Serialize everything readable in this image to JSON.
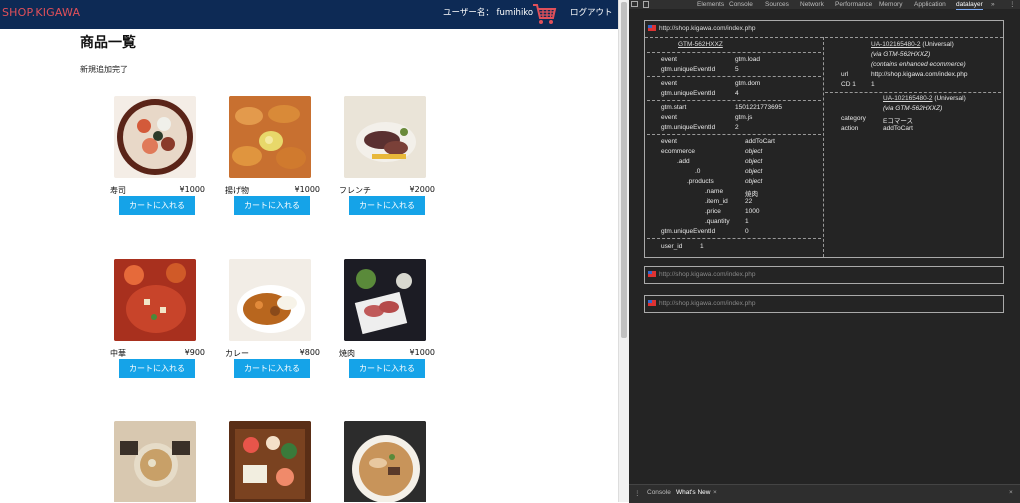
{
  "site": {
    "logo": "SHOP.KIGAWA",
    "user_label": "ユーザー名： fumihiko",
    "logout": "ログアウト",
    "title": "商品一覧",
    "status": "新規追加完了",
    "cart_button": "カートに入れる",
    "products": [
      {
        "name": "寿司",
        "price": "¥1000"
      },
      {
        "name": "揚げ物",
        "price": "¥1000"
      },
      {
        "name": "フレンチ",
        "price": "¥2000"
      },
      {
        "name": "中華",
        "price": "¥900"
      },
      {
        "name": "カレー",
        "price": "¥800"
      },
      {
        "name": "焼肉",
        "price": "¥1000"
      }
    ]
  },
  "devtools": {
    "tabs": [
      "Elements",
      "Console",
      "Sources",
      "Network",
      "Performance",
      "Memory",
      "Application",
      "datalayer"
    ],
    "tab_more": "»",
    "url": "http://shop.kigawa.com/index.php",
    "gtm": "GTM-562HXXZ",
    "events": {
      "e1": {
        "event": "gtm.load",
        "uid": "5"
      },
      "e2": {
        "event": "gtm.dom",
        "uid": "4"
      },
      "e3": {
        "start": "1501221773695",
        "event": "gtm.js",
        "uid": "2"
      },
      "e4": {
        "event": "addToCart",
        "ecommerce": "object",
        "add": "object",
        "zero": "object",
        "products": "object",
        "name": "焼肉",
        "item_id": "22",
        "price": "1000",
        "quantity": "1",
        "uid": "0"
      },
      "user_id": "1"
    },
    "labels": {
      "event": "event",
      "uid": "gtm.uniqueEventId",
      "start": "gtm.start",
      "ecommerce": "ecommerce",
      "add": ".add",
      "zero": ".0",
      "products": ".products",
      "name": ".name",
      "item_id": ".item_id",
      "price": ".price",
      "quantity": ".quantity",
      "user_id": "user_id",
      "url": "url",
      "cd1": "CD 1",
      "category": "category",
      "action": "action"
    },
    "right": {
      "ua1": "UA-102165480-2",
      "ua1_type": " (Universal)",
      "via1": "(via GTM-562HXXZ)",
      "enhanced": "(contains enhanced ecommerce)",
      "url_val": "http://shop.kigawa.com/index.php",
      "cd1_val": "1",
      "ua2": "UA-102165480-2",
      "ua2_type": " (Universal)",
      "via2": "(via GTM-562HXXZ)",
      "category_val": "Eコマース",
      "action_val": "addToCart"
    },
    "url2": "http://shop.kigawa.com/index.php",
    "url3": "http://shop.kigawa.com/index.php",
    "drawer_tabs": [
      "Console",
      "What's New"
    ]
  }
}
